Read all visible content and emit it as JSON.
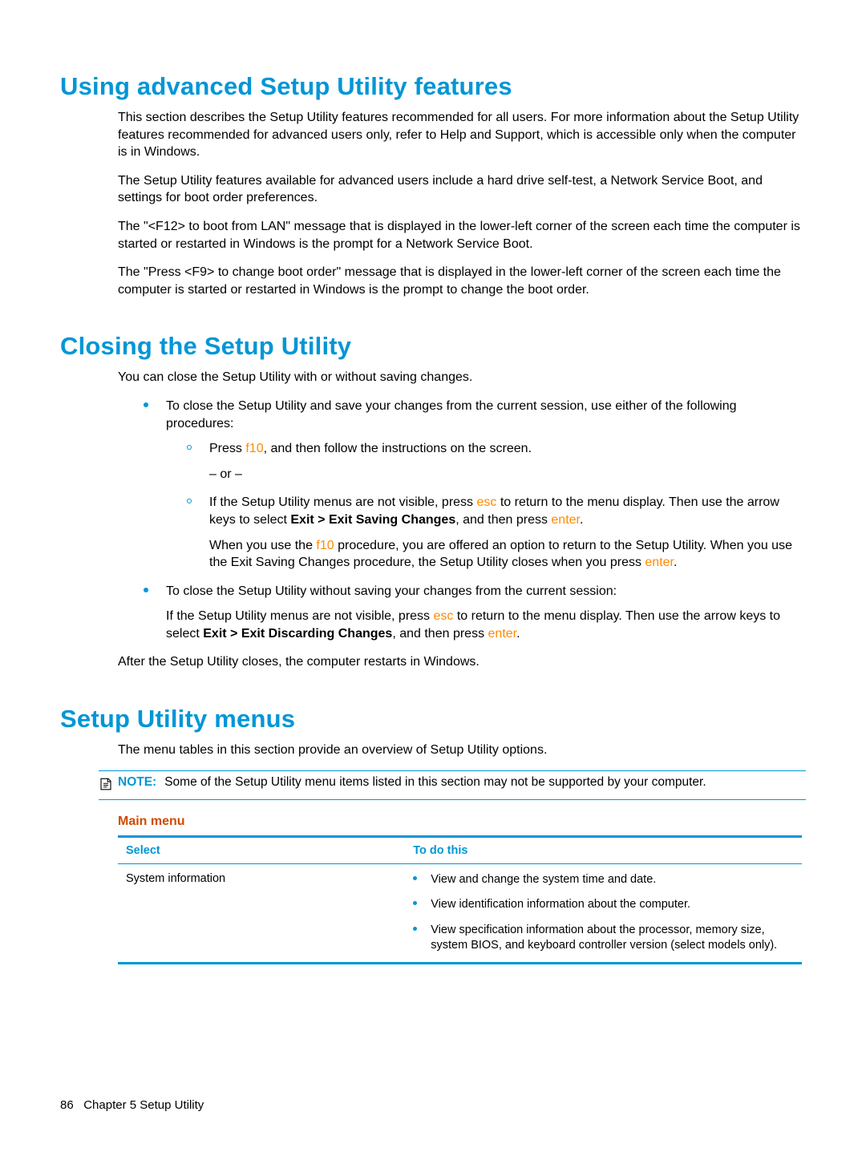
{
  "headings": {
    "h1a": "Using advanced Setup Utility features",
    "h1b": "Closing the Setup Utility",
    "h1c": "Setup Utility menus",
    "main_menu": "Main menu"
  },
  "advanced": {
    "p1": "This section describes the Setup Utility features recommended for all users. For more information about the Setup Utility features recommended for advanced users only, refer to Help and Support, which is accessible only when the computer is in Windows.",
    "p2": "The Setup Utility features available for advanced users include a hard drive self-test, a Network Service Boot, and settings for boot order preferences.",
    "p3": "The \"<F12> to boot from LAN\" message that is displayed in the lower-left corner of the screen each time the computer is started or restarted in Windows is the prompt for a Network Service Boot.",
    "p4": "The \"Press <F9> to change boot order\" message that is displayed in the lower-left corner of the screen each time the computer is started or restarted in Windows is the prompt to change the boot order."
  },
  "closing": {
    "intro": "You can close the Setup Utility with or without saving changes.",
    "b1": "To close the Setup Utility and save your changes from the current session, use either of the following procedures:",
    "s1_pre": "Press ",
    "s1_key": "f10",
    "s1_post": ", and then follow the instructions on the screen.",
    "or": "– or –",
    "s2_pre": "If the Setup Utility menus are not visible, press ",
    "s2_esc": "esc",
    "s2_mid": " to return to the menu display. Then use the arrow keys to select ",
    "s2_bold": "Exit > Exit Saving Changes",
    "s2_post": ", and then press ",
    "s2_enter": "enter",
    "s2_dot": ".",
    "s2_para_pre": "When you use the ",
    "s2_para_key": "f10",
    "s2_para_mid": " procedure, you are offered an option to return to the Setup Utility. When you use the Exit Saving Changes procedure, the Setup Utility closes when you press ",
    "s2_para_enter": "enter",
    "s2_para_dot": ".",
    "b2": "To close the Setup Utility without saving your changes from the current session:",
    "b2_para_pre": "If the Setup Utility menus are not visible, press ",
    "b2_para_esc": "esc",
    "b2_para_mid": " to return to the menu display. Then use the arrow keys to select ",
    "b2_para_bold": "Exit > Exit Discarding Changes",
    "b2_para_post": ", and then press ",
    "b2_para_enter": "enter",
    "b2_para_dot": ".",
    "after": "After the Setup Utility closes, the computer restarts in Windows."
  },
  "menus": {
    "intro": "The menu tables in this section provide an overview of Setup Utility options.",
    "note_label": "NOTE:",
    "note_text": "Some of the Setup Utility menu items listed in this section may not be supported by your computer.",
    "th1": "Select",
    "th2": "To do this",
    "row1_left": "System information",
    "row1_items": {
      "a": "View and change the system time and date.",
      "b": "View identification information about the computer.",
      "c": "View specification information about the processor, memory size, system BIOS, and keyboard controller version (select models only)."
    }
  },
  "footer": {
    "page": "86",
    "chapter_pre": "Chapter ",
    "chapter_num": "5",
    "chapter_title": "   Setup Utility"
  }
}
